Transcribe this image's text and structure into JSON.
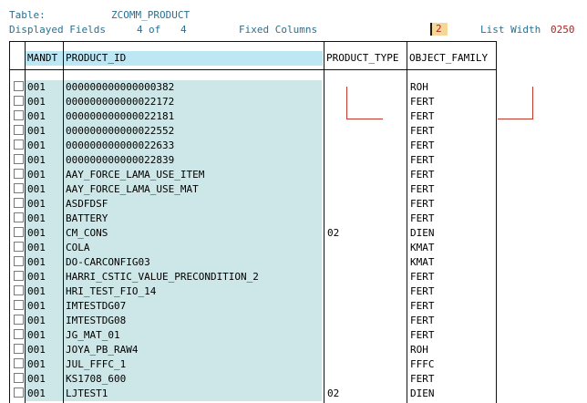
{
  "header": {
    "table_label": "Table:",
    "table_name": "ZCOMM_PRODUCT",
    "displayed_fields_label": "Displayed Fields",
    "displayed_fields_count": "4",
    "of_label": "of",
    "displayed_fields_total": "4",
    "fixed_columns_label": "Fixed Columns",
    "fixed_columns_value": "2",
    "list_width_label": "List Width",
    "list_width_value": "0250"
  },
  "columns": {
    "mandt": "MANDT",
    "product_id": "PRODUCT_ID",
    "product_type": "PRODUCT_TYPE",
    "object_family": "OBJECT_FAMILY"
  },
  "rows": [
    {
      "mandt": "001",
      "product_id": "000000000000000382",
      "product_type": "",
      "object_family": "ROH"
    },
    {
      "mandt": "001",
      "product_id": "000000000000022172",
      "product_type": "",
      "object_family": "FERT"
    },
    {
      "mandt": "001",
      "product_id": "000000000000022181",
      "product_type": "",
      "object_family": "FERT"
    },
    {
      "mandt": "001",
      "product_id": "000000000000022552",
      "product_type": "",
      "object_family": "FERT"
    },
    {
      "mandt": "001",
      "product_id": "000000000000022633",
      "product_type": "",
      "object_family": "FERT"
    },
    {
      "mandt": "001",
      "product_id": "000000000000022839",
      "product_type": "",
      "object_family": "FERT"
    },
    {
      "mandt": "001",
      "product_id": "AAY_FORCE_LAMA_USE_ITEM",
      "product_type": "",
      "object_family": "FERT"
    },
    {
      "mandt": "001",
      "product_id": "AAY_FORCE_LAMA_USE_MAT",
      "product_type": "",
      "object_family": "FERT"
    },
    {
      "mandt": "001",
      "product_id": "ASDFDSF",
      "product_type": "",
      "object_family": "FERT"
    },
    {
      "mandt": "001",
      "product_id": "BATTERY",
      "product_type": "",
      "object_family": "FERT"
    },
    {
      "mandt": "001",
      "product_id": "CM_CONS",
      "product_type": "02",
      "object_family": "DIEN"
    },
    {
      "mandt": "001",
      "product_id": "COLA",
      "product_type": "",
      "object_family": "KMAT"
    },
    {
      "mandt": "001",
      "product_id": "DO-CARCONFIG03",
      "product_type": "",
      "object_family": "KMAT"
    },
    {
      "mandt": "001",
      "product_id": "HARRI_CSTIC_VALUE_PRECONDITION_2",
      "product_type": "",
      "object_family": "FERT"
    },
    {
      "mandt": "001",
      "product_id": "HRI_TEST_FIO_14",
      "product_type": "",
      "object_family": "FERT"
    },
    {
      "mandt": "001",
      "product_id": "IMTESTDG07",
      "product_type": "",
      "object_family": "FERT"
    },
    {
      "mandt": "001",
      "product_id": "IMTESTDG08",
      "product_type": "",
      "object_family": "FERT"
    },
    {
      "mandt": "001",
      "product_id": "JG_MAT_01",
      "product_type": "",
      "object_family": "FERT"
    },
    {
      "mandt": "001",
      "product_id": "JOYA_PB_RAW4",
      "product_type": "",
      "object_family": "ROH"
    },
    {
      "mandt": "001",
      "product_id": "JUL_FFFC_1",
      "product_type": "",
      "object_family": "FFFC"
    },
    {
      "mandt": "001",
      "product_id": "KS1708_600",
      "product_type": "",
      "object_family": "FERT"
    },
    {
      "mandt": "001",
      "product_id": "LJTEST1",
      "product_type": "02",
      "object_family": "DIEN"
    }
  ]
}
